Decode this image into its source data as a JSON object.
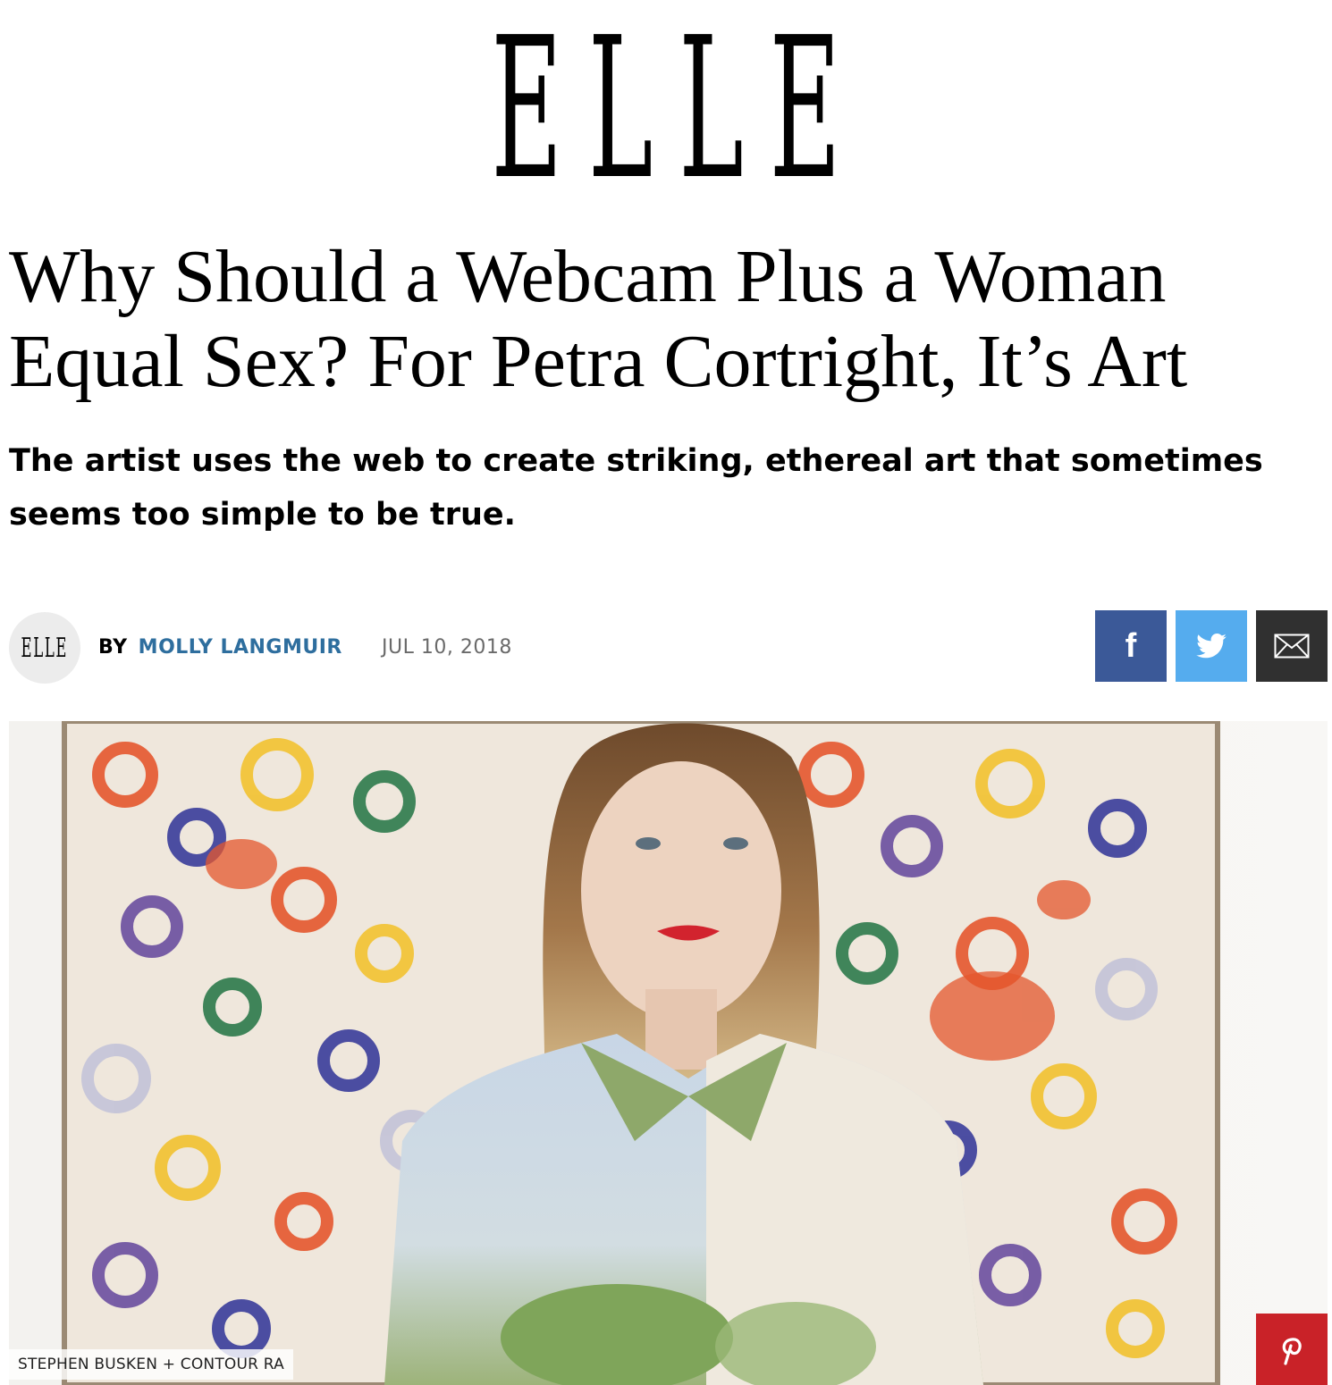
{
  "masthead": {
    "logo": "ELLE"
  },
  "article": {
    "headline": "Why Should a Webcam Plus a Woman Equal Sex? For Petra Cortright, It’s Art",
    "dek": "The artist uses the web to create striking, ethereal art that sometimes seems too simple to be true."
  },
  "byline": {
    "avatar_text": "ELLE",
    "by": "BY",
    "author": "MOLLY LANGMUIR",
    "date": "JUL 10, 2018"
  },
  "share": {
    "facebook_icon": "facebook-icon",
    "twitter_icon": "twitter-icon",
    "email_icon": "email-icon",
    "facebook_label": "f"
  },
  "hero": {
    "credit": "STEPHEN BUSKEN + CONTOUR RA",
    "pin_icon": "pinterest-icon"
  },
  "colors": {
    "author_link": "#2e6e9e",
    "facebook": "#3b5998",
    "twitter": "#55acee",
    "email": "#303030",
    "pinterest": "#c92228"
  }
}
